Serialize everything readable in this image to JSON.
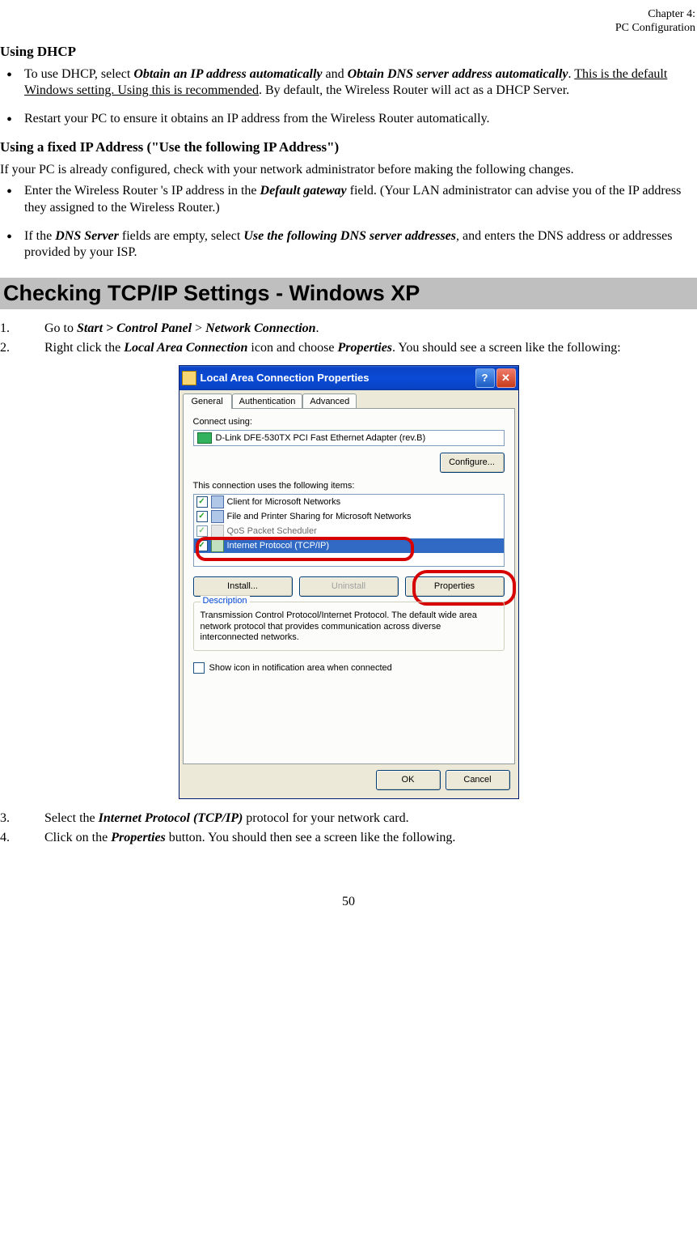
{
  "header": {
    "line1": "Chapter 4:",
    "line2": "PC Configuration"
  },
  "sec1": {
    "title": "Using DHCP",
    "b1_pre": "To use DHCP, select ",
    "b1_e1": "Obtain an IP address automatically",
    "b1_mid1": " and ",
    "b1_e2": "Obtain DNS server address automatically",
    "b1_mid2": ". ",
    "b1_u": "This is the default Windows setting. Using this is recommended",
    "b1_post": ". By default, the Wireless Router will act as a DHCP Server.",
    "b2": "Restart your PC to ensure it obtains an IP address from the Wireless Router automatically."
  },
  "sec2": {
    "title": "Using a fixed IP Address (\"Use the following IP Address\")",
    "intro": "If your PC is already configured, check with your network administrator before making the following changes.",
    "b1_pre": "Enter the Wireless Router 's IP address in the ",
    "b1_e1": "Default gateway",
    "b1_post": " field. (Your LAN administrator can advise you of the IP address they assigned to the Wireless Router.)",
    "b2_pre": "If the ",
    "b2_e1": "DNS Server",
    "b2_mid1": " fields are empty, select ",
    "b2_e2": "Use the following DNS server addresses",
    "b2_post": ", and enters the DNS address or addresses provided by your ISP."
  },
  "section_title": "Checking TCP/IP Settings - Windows XP",
  "steps": {
    "s1_num": "1.",
    "s1_pre": "Go to ",
    "s1_e1": "Start > Control Panel",
    "s1_mid": " > ",
    "s1_e2": "Network Connection",
    "s1_post": ".",
    "s2_num": "2.",
    "s2_pre": "Right click the ",
    "s2_e1": "Local Area Connection",
    "s2_mid": " icon and choose ",
    "s2_e2": "Properties",
    "s2_post": ". You should see a screen like the following:",
    "s3_num": "3.",
    "s3_pre": "Select the ",
    "s3_e1": "Internet Protocol (TCP/IP)",
    "s3_post": " protocol for your network card.",
    "s4_num": "4.",
    "s4_pre": "Click on the ",
    "s4_e1": "Properties",
    "s4_post": " button. You should then see a screen like the following."
  },
  "dialog": {
    "title": "Local Area Connection Properties",
    "tabs": [
      "General",
      "Authentication",
      "Advanced"
    ],
    "connect_label": "Connect using:",
    "adapter": "D-Link DFE-530TX PCI Fast Ethernet Adapter (rev.B)",
    "configure": "Configure...",
    "items_label": "This connection uses the following items:",
    "items": [
      "Client for Microsoft Networks",
      "File and Printer Sharing for Microsoft Networks",
      "QoS Packet Scheduler",
      "Internet Protocol (TCP/IP)"
    ],
    "install": "Install...",
    "uninstall": "Uninstall",
    "properties": "Properties",
    "desc_title": "Description",
    "desc": "Transmission Control Protocol/Internet Protocol. The default wide area network protocol that provides communication across diverse interconnected networks.",
    "show_icon": "Show icon in notification area when connected",
    "ok": "OK",
    "cancel": "Cancel"
  },
  "pagenum": "50"
}
